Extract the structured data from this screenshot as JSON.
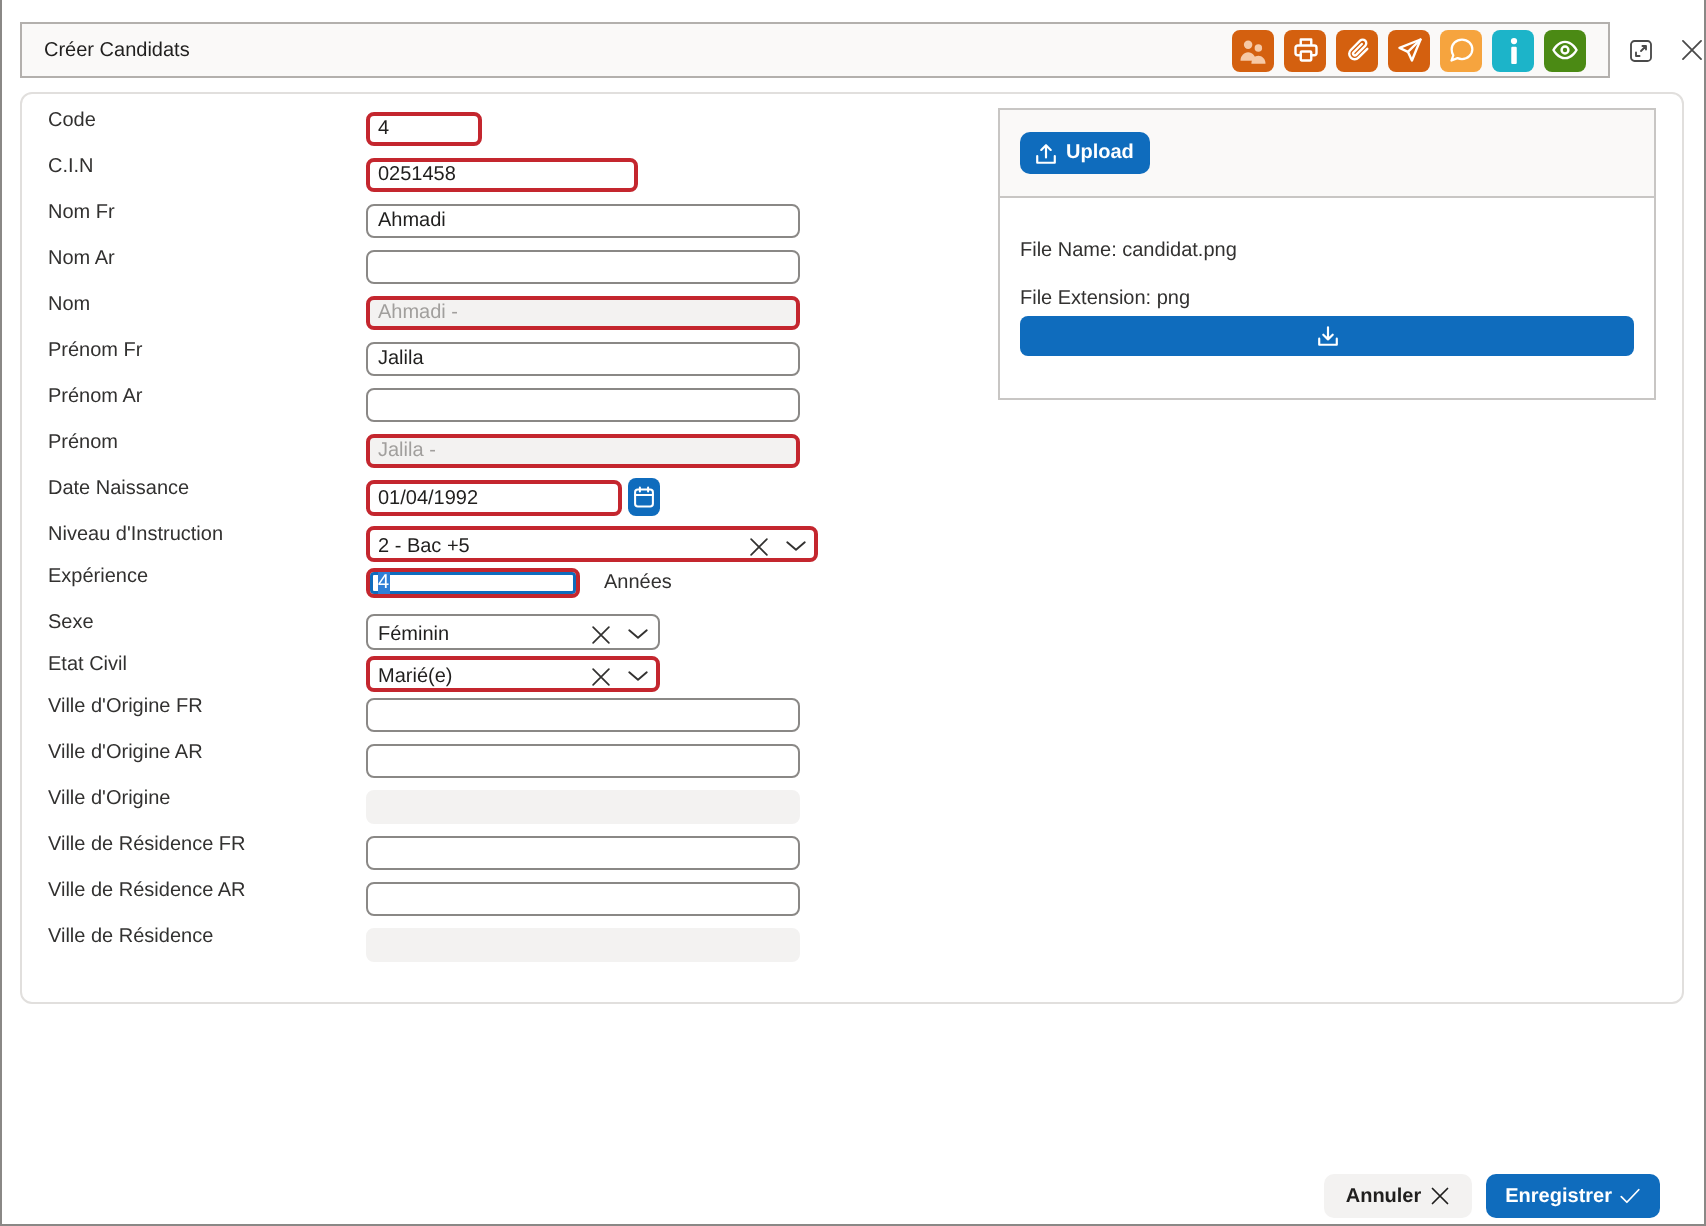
{
  "dialog": {
    "title": "Créer Candidats"
  },
  "toolbar": [
    {
      "kind": "people",
      "color": "#d4600f"
    },
    {
      "kind": "print",
      "color": "#d4600f"
    },
    {
      "kind": "attach",
      "color": "#d4600f"
    },
    {
      "kind": "send",
      "color": "#d4600f"
    },
    {
      "kind": "comment",
      "color": "#f6a43e"
    },
    {
      "kind": "info",
      "color": "#1cb4c9"
    },
    {
      "kind": "view",
      "color": "#4b8a14"
    }
  ],
  "fields": [
    {
      "label": "Code",
      "kind": "text",
      "value": "4",
      "invalid": true,
      "disabled": false,
      "focused": false
    },
    {
      "label": "C.I.N",
      "kind": "text",
      "value": "0251458",
      "invalid": true,
      "disabled": false,
      "focused": false
    },
    {
      "label": "Nom Fr",
      "kind": "text",
      "value": "Ahmadi",
      "invalid": false,
      "disabled": false,
      "focused": false
    },
    {
      "label": "Nom Ar",
      "kind": "text",
      "invalid": false,
      "disabled": false,
      "focused": false
    },
    {
      "label": "Nom",
      "kind": "text",
      "value": "Ahmadi -",
      "invalid": true,
      "disabled": true,
      "focused": false
    },
    {
      "label": "Prénom Fr",
      "kind": "text",
      "value": "Jalila",
      "invalid": false,
      "disabled": false,
      "focused": false
    },
    {
      "label": "Prénom Ar",
      "kind": "text",
      "invalid": false,
      "disabled": false,
      "focused": false
    },
    {
      "label": "Prénom",
      "kind": "text",
      "value": "Jalila -",
      "invalid": true,
      "disabled": true,
      "focused": false
    },
    {
      "label": "Date Naissance",
      "kind": "date",
      "value": "01/04/1992",
      "invalid": true,
      "disabled": false,
      "focused": false
    },
    {
      "label": "Niveau d'Instruction",
      "kind": "select",
      "value": "2 - Bac +5",
      "invalid": true,
      "disabled": false,
      "focused": false
    },
    {
      "label": "Expérience",
      "kind": "number",
      "value": "4",
      "unit": "Années",
      "invalid": true,
      "disabled": false,
      "focused": true
    },
    {
      "label": "Sexe",
      "kind": "select",
      "value": "Féminin",
      "invalid": false,
      "disabled": false,
      "focused": false
    },
    {
      "label": "Etat Civil",
      "kind": "select",
      "value": "Marié(e)",
      "invalid": true,
      "disabled": false,
      "focused": false
    },
    {
      "label": "Ville d'Origine FR",
      "kind": "text",
      "invalid": false,
      "disabled": false,
      "focused": false
    },
    {
      "label": "Ville d'Origine AR",
      "kind": "text",
      "invalid": false,
      "disabled": false,
      "focused": false
    },
    {
      "label": "Ville d'Origine",
      "kind": "text",
      "invalid": false,
      "disabled": true,
      "focused": false
    },
    {
      "label": "Ville de Résidence FR",
      "kind": "text",
      "invalid": false,
      "disabled": false,
      "focused": false
    },
    {
      "label": "Ville de Résidence AR",
      "kind": "text",
      "invalid": false,
      "disabled": false,
      "focused": false
    },
    {
      "label": "Ville de Résidence",
      "kind": "text",
      "invalid": false,
      "disabled": true,
      "focused": false
    }
  ],
  "upload": {
    "button": "Upload",
    "file_name": "File Name: candidat.png",
    "file_extension": "File Extension: png"
  },
  "actions": [
    {
      "label": "Annuler",
      "kind": "cancel"
    },
    {
      "label": "Enregistrer",
      "kind": "save"
    }
  ]
}
